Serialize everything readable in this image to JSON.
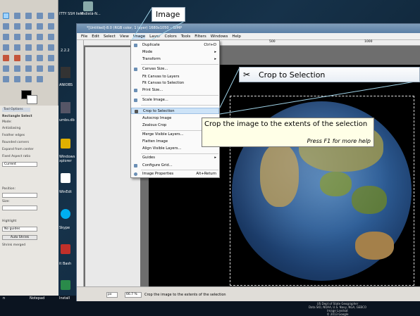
{
  "desktop": {
    "icons": [
      {
        "label": "ITTY SSH\nlient"
      },
      {
        "label": "Yhdistä-N..."
      },
      {
        "label": "2.2.2"
      },
      {
        "label": "ANIOBS"
      },
      {
        "label": "umbs.db"
      },
      {
        "label": "Windows\nxplorer"
      },
      {
        "label": "WinEdt"
      },
      {
        "label": "Skype"
      },
      {
        "label": "it Bash"
      }
    ],
    "bottom_labels": [
      "n",
      "Notepad",
      "Install"
    ]
  },
  "toolbox": {
    "tab_label": "Tool Options",
    "options": [
      "Rectangle Select",
      "Mode:",
      "Antialiasing",
      "Feather edges",
      "Rounded corners",
      "Expand from center",
      "Fixed  Aspect ratio",
      "Current",
      "Position:",
      "Size:",
      "Highlight",
      "No guides",
      "Auto Shrink",
      "Shrink merged"
    ]
  },
  "window": {
    "title": "*[Untitled]-8.0 (RGB color, 1 layer) 1680x1050 – GIMP",
    "menus": [
      "File",
      "Edit",
      "Select",
      "View",
      "Image",
      "Layer",
      "Colors",
      "Tools",
      "Filters",
      "Windows",
      "Help"
    ],
    "ruler_marks": [
      "500",
      "1000"
    ],
    "image_credit": [
      "US Dept of State Geographer",
      "Data SIO, NOAA, U.S. Navy, NGA, GEBCO",
      "Image Landsat",
      "© 2013 Google"
    ]
  },
  "image_menu": {
    "items": [
      {
        "label": "Duplicate",
        "accel": "Ctrl+D"
      },
      {
        "label": "Mode",
        "accel": "▸"
      },
      {
        "label": "Transform",
        "accel": "▸"
      },
      {
        "label": "Canvas Size...",
        "accel": ""
      },
      {
        "label": "Fit Canvas to Layers",
        "accel": ""
      },
      {
        "label": "Fit Canvas to Selection",
        "accel": ""
      },
      {
        "label": "Print Size...",
        "accel": ""
      },
      {
        "label": "Scale Image...",
        "accel": ""
      },
      {
        "label": "Crop to Selection",
        "accel": ""
      },
      {
        "label": "Autocrop Image",
        "accel": ""
      },
      {
        "label": "Zealous Crop",
        "accel": ""
      },
      {
        "label": "Merge Visible Layers...",
        "accel": ""
      },
      {
        "label": "Flatten Image",
        "accel": ""
      },
      {
        "label": "Align Visible Layers...",
        "accel": ""
      },
      {
        "label": "Guides",
        "accel": "▸"
      },
      {
        "label": "Configure Grid...",
        "accel": ""
      },
      {
        "label": "Image Properties",
        "accel": "Alt+Return"
      }
    ]
  },
  "callouts": {
    "image": "Image",
    "crop": "Crop to Selection"
  },
  "tooltip": {
    "main": "Crop the image to the extents of the selection",
    "help": "Press F1 for more help"
  },
  "statusbar": {
    "unit": "px",
    "zoom": "66.7 %",
    "message": "Crop the image to the extents of the selection"
  },
  "colors": {
    "menu_highlight": "#cde3f7",
    "titlebar": "#5b7fa6",
    "tooltip_bg": "#ffffe7"
  }
}
